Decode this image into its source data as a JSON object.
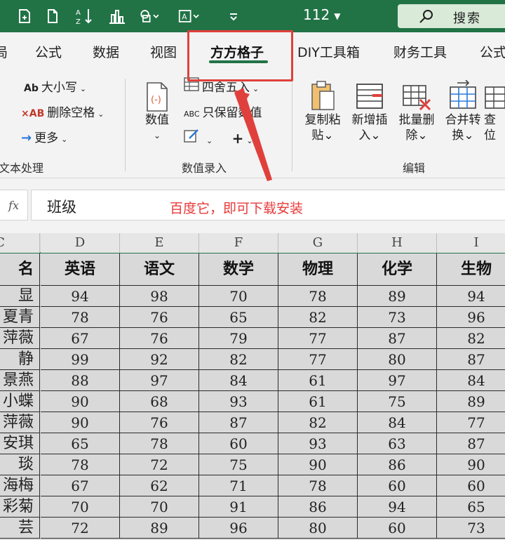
{
  "quick_access": {
    "icons": [
      "save-to-cloud-icon",
      "new-document-icon",
      "sort-az-icon",
      "chart-icon",
      "shapes-icon",
      "textbox-icon",
      "customize-qat-icon"
    ],
    "zoom": "112",
    "search_label": "搜索"
  },
  "tabs": [
    "局",
    "公式",
    "数据",
    "视图",
    "方方格子",
    "DIY工具箱",
    "财务工具",
    "公式"
  ],
  "active_tab": "方方格子",
  "ribbon": {
    "text_group": {
      "items": [
        {
          "icon": "Ab",
          "label": "大小写"
        },
        {
          "icon": "×AB",
          "label": "删除空格"
        },
        {
          "icon": "→",
          "label": "更多"
        }
      ],
      "label": "文本处理"
    },
    "number_group": {
      "big_button": {
        "line1": "数值",
        "line2": ""
      },
      "items": [
        {
          "label": "四舍五入"
        },
        {
          "icon": "ABC",
          "label": "只保留数值"
        },
        {
          "label": "+"
        }
      ],
      "label": "数值录入"
    },
    "edit_group": {
      "buttons": [
        {
          "line1": "复制粘",
          "line2": "贴"
        },
        {
          "line1": "新增插",
          "line2": "入"
        },
        {
          "line1": "批量删",
          "line2": "除"
        },
        {
          "line1": "合并转",
          "line2": "换"
        },
        {
          "line1": "查",
          "line2": "位"
        }
      ],
      "label": "编辑"
    }
  },
  "formula_bar": {
    "fx": "fx",
    "value": "班级",
    "annotation": "百度它，即可下载安装"
  },
  "sheet": {
    "col_letters": [
      "C",
      "D",
      "E",
      "F",
      "G",
      "H",
      "I"
    ],
    "headers": [
      "名",
      "英语",
      "语文",
      "数学",
      "物理",
      "化学",
      "生物"
    ],
    "rows": [
      [
        "显",
        "94",
        "98",
        "70",
        "78",
        "89",
        "94"
      ],
      [
        "夏青",
        "78",
        "76",
        "65",
        "82",
        "73",
        "96"
      ],
      [
        "萍薇",
        "67",
        "76",
        "79",
        "77",
        "87",
        "82"
      ],
      [
        "静",
        "99",
        "92",
        "82",
        "77",
        "80",
        "87"
      ],
      [
        "景燕",
        "88",
        "97",
        "84",
        "61",
        "97",
        "84"
      ],
      [
        "小蝶",
        "90",
        "68",
        "93",
        "61",
        "75",
        "89"
      ],
      [
        "萍薇",
        "90",
        "76",
        "87",
        "82",
        "84",
        "77"
      ],
      [
        "安琪",
        "65",
        "78",
        "60",
        "93",
        "63",
        "87"
      ],
      [
        "琰",
        "78",
        "72",
        "75",
        "90",
        "86",
        "90"
      ],
      [
        "海梅",
        "67",
        "62",
        "71",
        "78",
        "60",
        "60"
      ],
      [
        "彩菊",
        "70",
        "70",
        "91",
        "86",
        "94",
        "65"
      ],
      [
        "芸",
        "72",
        "89",
        "96",
        "80",
        "60",
        "73"
      ]
    ]
  },
  "colors": {
    "accent": "#217346",
    "annotation_red": "#e0403c"
  }
}
